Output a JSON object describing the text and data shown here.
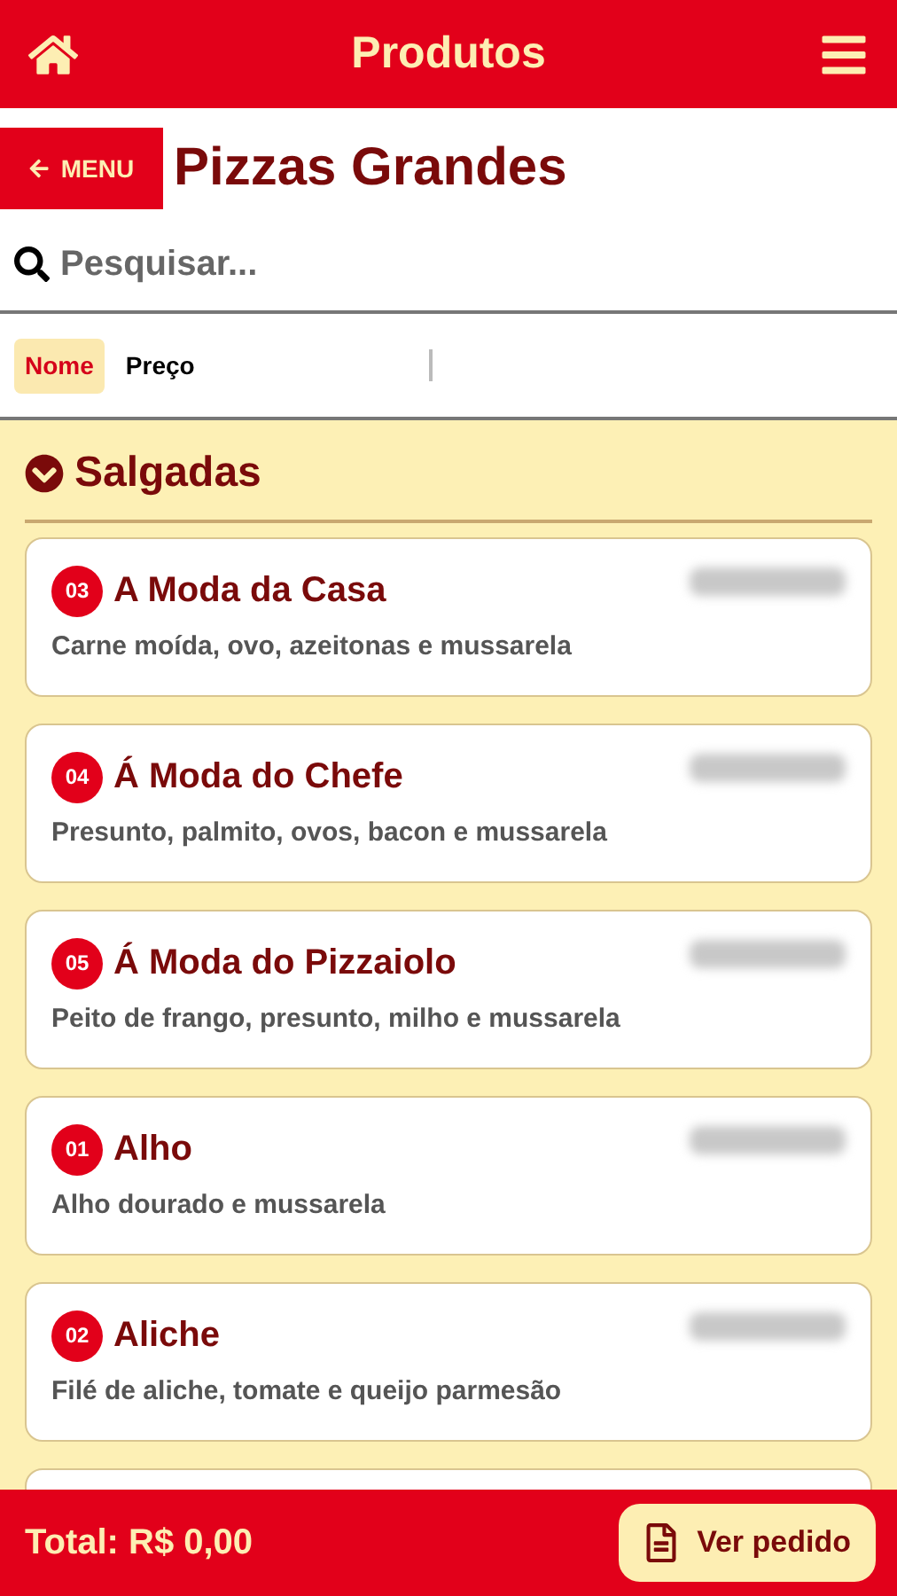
{
  "header": {
    "title": "Produtos"
  },
  "back_button": {
    "label": "MENU"
  },
  "page_title": "Pizzas Grandes",
  "search": {
    "placeholder": "Pesquisar..."
  },
  "sort_tabs": [
    {
      "label": "Nome",
      "selected": true
    },
    {
      "label": "Preço",
      "selected": false
    }
  ],
  "section": {
    "title": "Salgadas",
    "expanded": true
  },
  "products": [
    {
      "number": "03",
      "name": "A Moda da Casa",
      "description": "Carne moída, ovo, azeitonas e mussarela"
    },
    {
      "number": "04",
      "name": "Á Moda do Chefe",
      "description": "Presunto, palmito, ovos, bacon e mussarela"
    },
    {
      "number": "05",
      "name": "Á Moda do Pizzaiolo",
      "description": "Peito de frango, presunto, milho e mussarela"
    },
    {
      "number": "01",
      "name": "Alho",
      "description": "Alho dourado e mussarela"
    },
    {
      "number": "02",
      "name": "Aliche",
      "description": "Filé de aliche, tomate e queijo parmesão"
    }
  ],
  "footer": {
    "total": "Total: R$ 0,00",
    "order_button": "Ver pedido"
  }
}
